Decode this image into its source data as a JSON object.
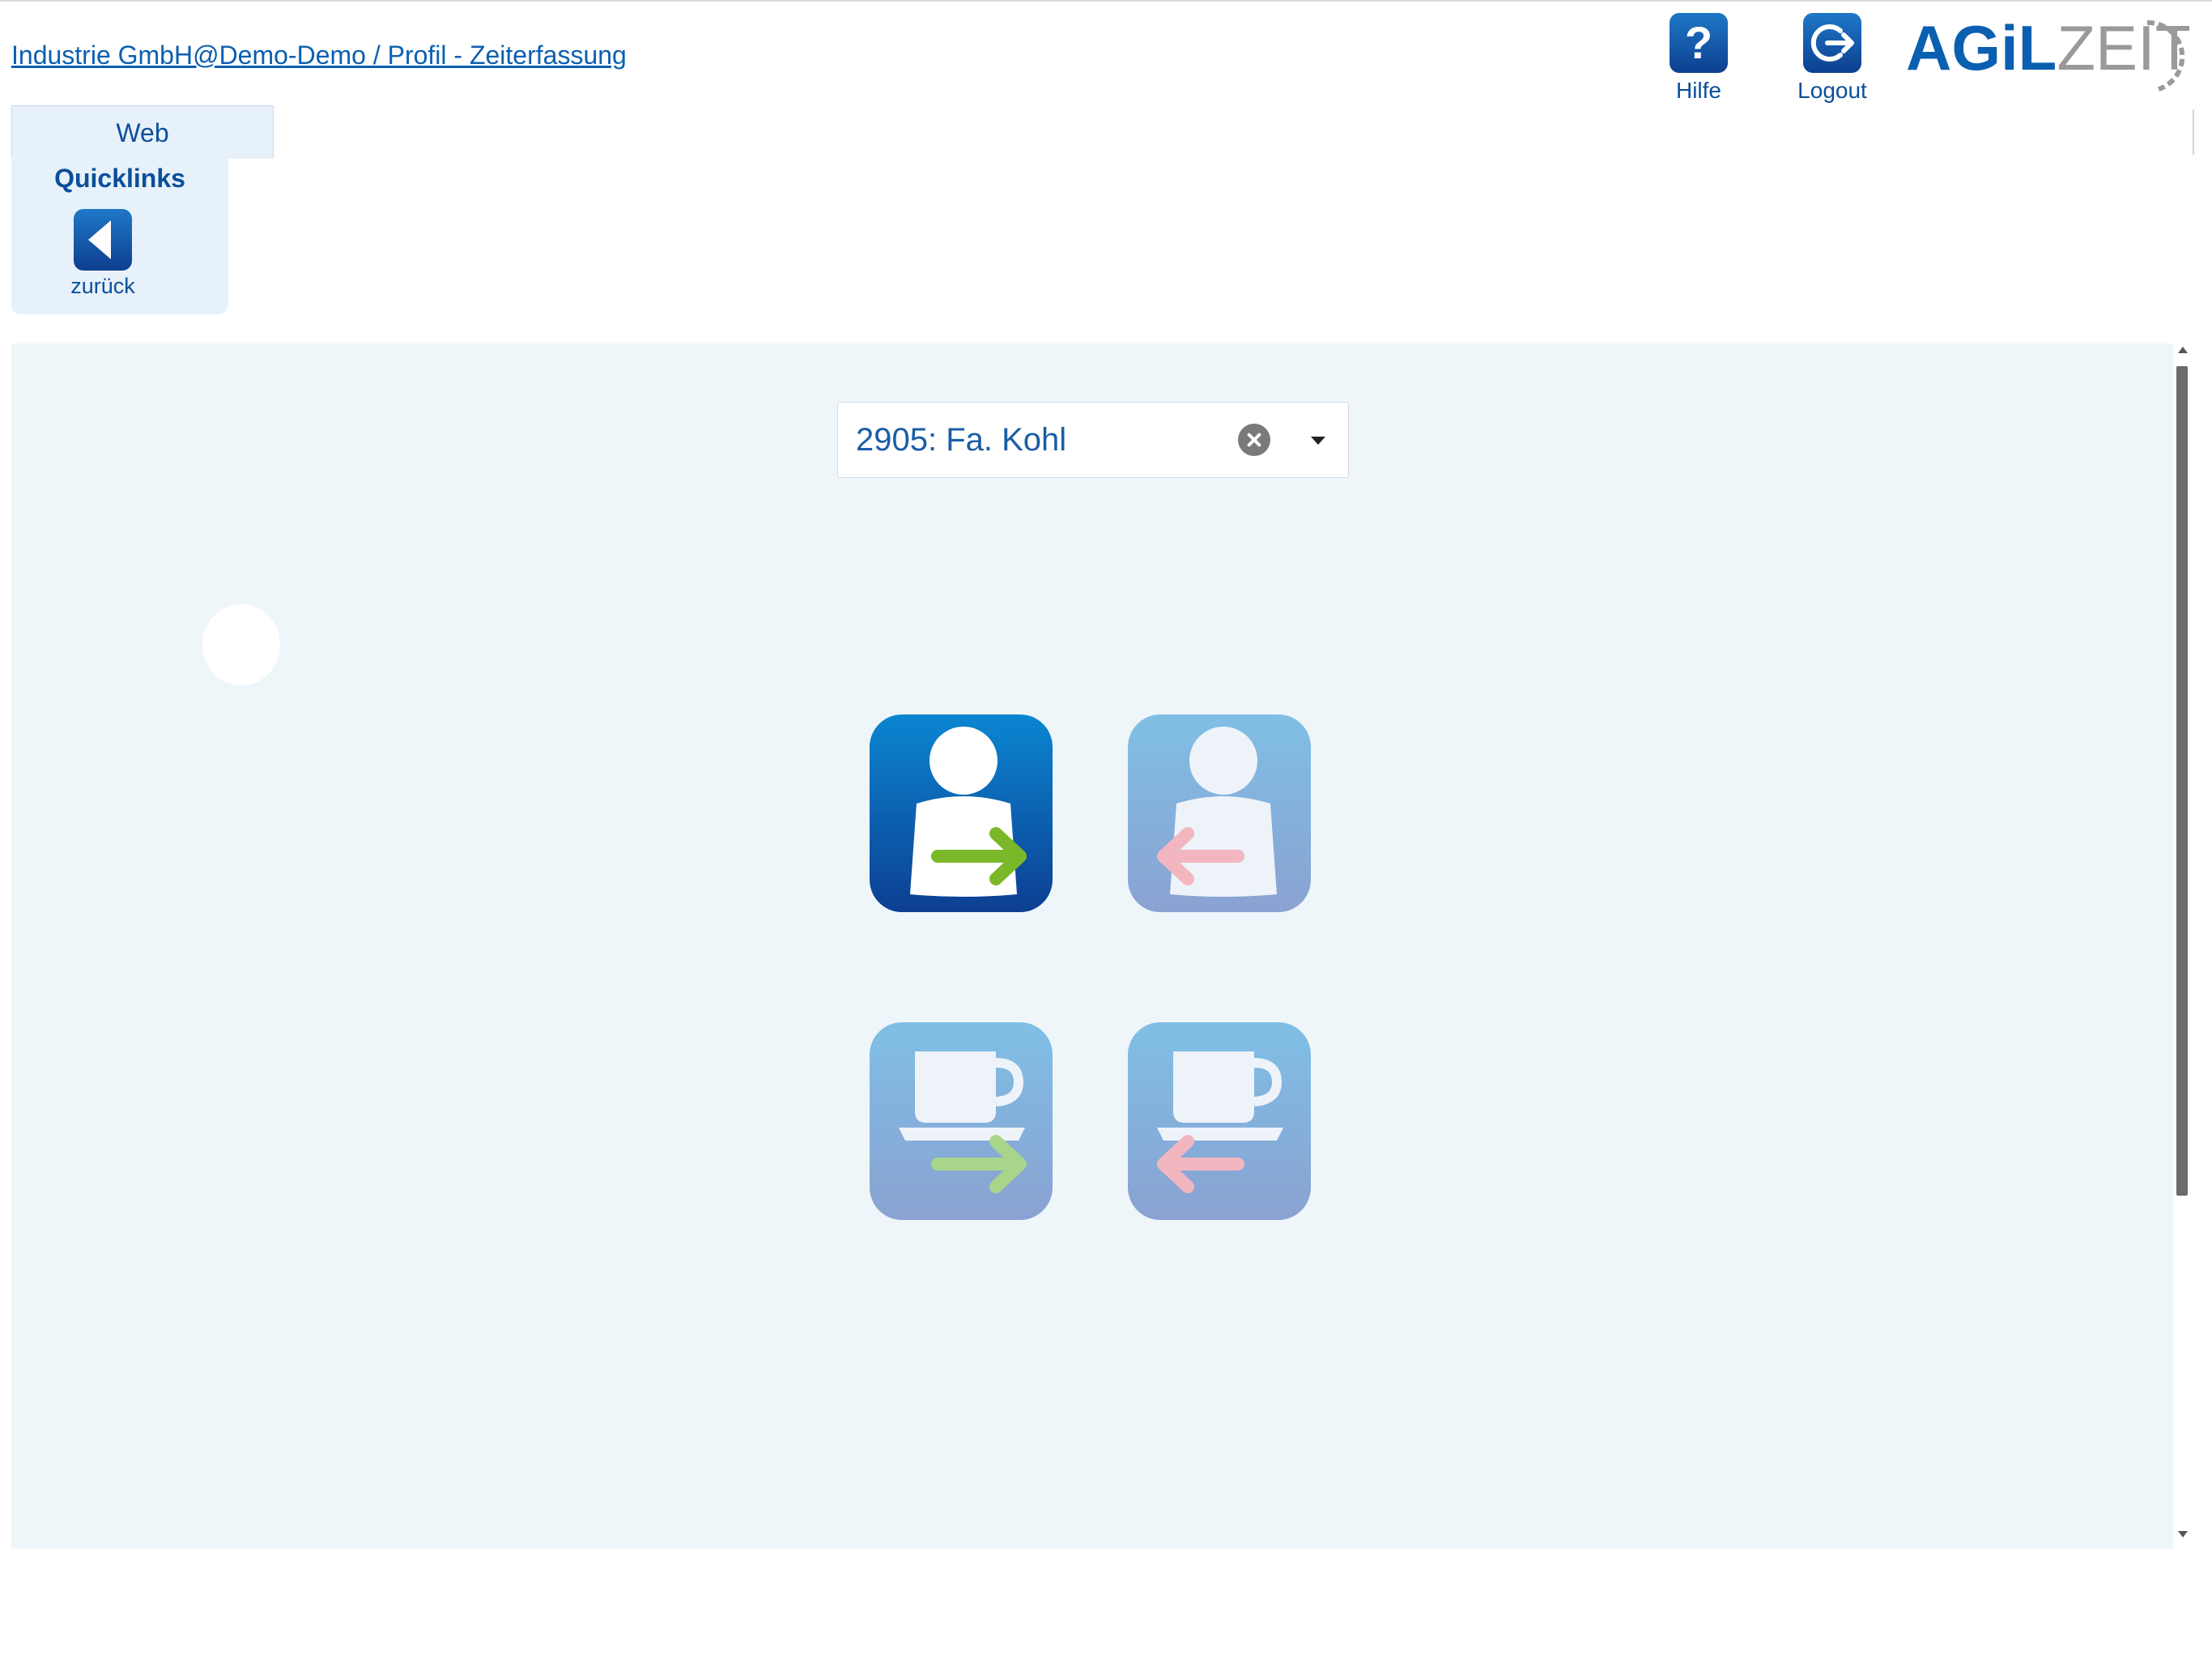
{
  "header": {
    "breadcrumb": "Industrie GmbH@Demo-Demo / Profil - Zeiterfassung",
    "help_label": "Hilfe",
    "logout_label": "Logout",
    "logo": {
      "text_bold": "AGiL",
      "text_light": "ZEIT"
    }
  },
  "tabs": [
    {
      "label": "Web"
    }
  ],
  "quicklinks": {
    "title": "Quicklinks",
    "items": [
      {
        "label": "zurück",
        "icon": "back-icon"
      }
    ]
  },
  "main": {
    "customer_select": {
      "value": "2905: Fa. Kohl"
    },
    "actions": [
      {
        "name": "kommen",
        "icon": "person-arrow-in-icon",
        "state": "active"
      },
      {
        "name": "gehen",
        "icon": "person-arrow-out-icon",
        "state": "disabled"
      },
      {
        "name": "pause-beginn",
        "icon": "coffee-arrow-in-icon",
        "state": "disabled"
      },
      {
        "name": "pause-ende",
        "icon": "coffee-arrow-out-icon",
        "state": "disabled"
      }
    ]
  },
  "colors": {
    "brand_blue": "#0b4f9a",
    "link_blue": "#0b5fb0",
    "panel_bg": "#eff6fa",
    "arrow_in_green": "#7ab829",
    "arrow_out_pink": "#f2b6c0"
  }
}
